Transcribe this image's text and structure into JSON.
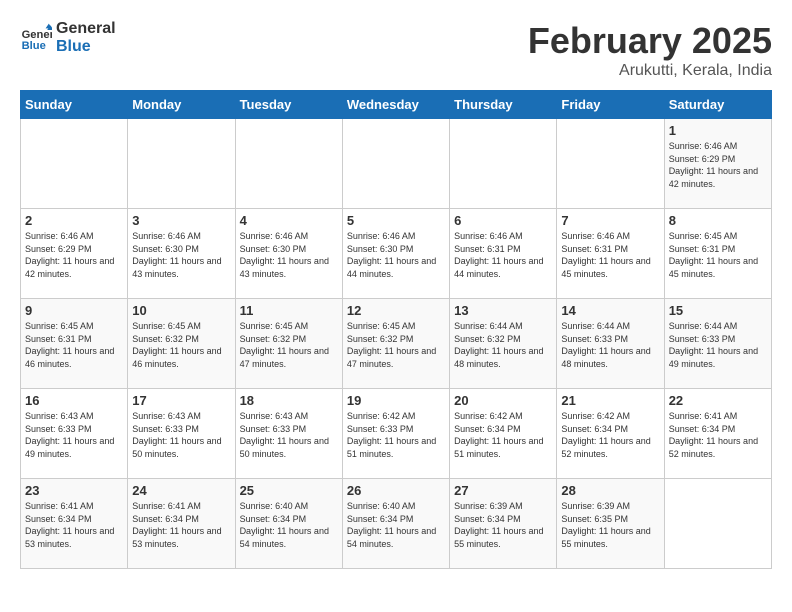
{
  "logo": {
    "text_general": "General",
    "text_blue": "Blue"
  },
  "header": {
    "title": "February 2025",
    "subtitle": "Arukutti, Kerala, India"
  },
  "weekdays": [
    "Sunday",
    "Monday",
    "Tuesday",
    "Wednesday",
    "Thursday",
    "Friday",
    "Saturday"
  ],
  "weeks": [
    [
      {
        "day": "",
        "info": ""
      },
      {
        "day": "",
        "info": ""
      },
      {
        "day": "",
        "info": ""
      },
      {
        "day": "",
        "info": ""
      },
      {
        "day": "",
        "info": ""
      },
      {
        "day": "",
        "info": ""
      },
      {
        "day": "1",
        "info": "Sunrise: 6:46 AM\nSunset: 6:29 PM\nDaylight: 11 hours and 42 minutes."
      }
    ],
    [
      {
        "day": "2",
        "info": "Sunrise: 6:46 AM\nSunset: 6:29 PM\nDaylight: 11 hours and 42 minutes."
      },
      {
        "day": "3",
        "info": "Sunrise: 6:46 AM\nSunset: 6:30 PM\nDaylight: 11 hours and 43 minutes."
      },
      {
        "day": "4",
        "info": "Sunrise: 6:46 AM\nSunset: 6:30 PM\nDaylight: 11 hours and 43 minutes."
      },
      {
        "day": "5",
        "info": "Sunrise: 6:46 AM\nSunset: 6:30 PM\nDaylight: 11 hours and 44 minutes."
      },
      {
        "day": "6",
        "info": "Sunrise: 6:46 AM\nSunset: 6:31 PM\nDaylight: 11 hours and 44 minutes."
      },
      {
        "day": "7",
        "info": "Sunrise: 6:46 AM\nSunset: 6:31 PM\nDaylight: 11 hours and 45 minutes."
      },
      {
        "day": "8",
        "info": "Sunrise: 6:45 AM\nSunset: 6:31 PM\nDaylight: 11 hours and 45 minutes."
      }
    ],
    [
      {
        "day": "9",
        "info": "Sunrise: 6:45 AM\nSunset: 6:31 PM\nDaylight: 11 hours and 46 minutes."
      },
      {
        "day": "10",
        "info": "Sunrise: 6:45 AM\nSunset: 6:32 PM\nDaylight: 11 hours and 46 minutes."
      },
      {
        "day": "11",
        "info": "Sunrise: 6:45 AM\nSunset: 6:32 PM\nDaylight: 11 hours and 47 minutes."
      },
      {
        "day": "12",
        "info": "Sunrise: 6:45 AM\nSunset: 6:32 PM\nDaylight: 11 hours and 47 minutes."
      },
      {
        "day": "13",
        "info": "Sunrise: 6:44 AM\nSunset: 6:32 PM\nDaylight: 11 hours and 48 minutes."
      },
      {
        "day": "14",
        "info": "Sunrise: 6:44 AM\nSunset: 6:33 PM\nDaylight: 11 hours and 48 minutes."
      },
      {
        "day": "15",
        "info": "Sunrise: 6:44 AM\nSunset: 6:33 PM\nDaylight: 11 hours and 49 minutes."
      }
    ],
    [
      {
        "day": "16",
        "info": "Sunrise: 6:43 AM\nSunset: 6:33 PM\nDaylight: 11 hours and 49 minutes."
      },
      {
        "day": "17",
        "info": "Sunrise: 6:43 AM\nSunset: 6:33 PM\nDaylight: 11 hours and 50 minutes."
      },
      {
        "day": "18",
        "info": "Sunrise: 6:43 AM\nSunset: 6:33 PM\nDaylight: 11 hours and 50 minutes."
      },
      {
        "day": "19",
        "info": "Sunrise: 6:42 AM\nSunset: 6:33 PM\nDaylight: 11 hours and 51 minutes."
      },
      {
        "day": "20",
        "info": "Sunrise: 6:42 AM\nSunset: 6:34 PM\nDaylight: 11 hours and 51 minutes."
      },
      {
        "day": "21",
        "info": "Sunrise: 6:42 AM\nSunset: 6:34 PM\nDaylight: 11 hours and 52 minutes."
      },
      {
        "day": "22",
        "info": "Sunrise: 6:41 AM\nSunset: 6:34 PM\nDaylight: 11 hours and 52 minutes."
      }
    ],
    [
      {
        "day": "23",
        "info": "Sunrise: 6:41 AM\nSunset: 6:34 PM\nDaylight: 11 hours and 53 minutes."
      },
      {
        "day": "24",
        "info": "Sunrise: 6:41 AM\nSunset: 6:34 PM\nDaylight: 11 hours and 53 minutes."
      },
      {
        "day": "25",
        "info": "Sunrise: 6:40 AM\nSunset: 6:34 PM\nDaylight: 11 hours and 54 minutes."
      },
      {
        "day": "26",
        "info": "Sunrise: 6:40 AM\nSunset: 6:34 PM\nDaylight: 11 hours and 54 minutes."
      },
      {
        "day": "27",
        "info": "Sunrise: 6:39 AM\nSunset: 6:34 PM\nDaylight: 11 hours and 55 minutes."
      },
      {
        "day": "28",
        "info": "Sunrise: 6:39 AM\nSunset: 6:35 PM\nDaylight: 11 hours and 55 minutes."
      },
      {
        "day": "",
        "info": ""
      }
    ]
  ]
}
